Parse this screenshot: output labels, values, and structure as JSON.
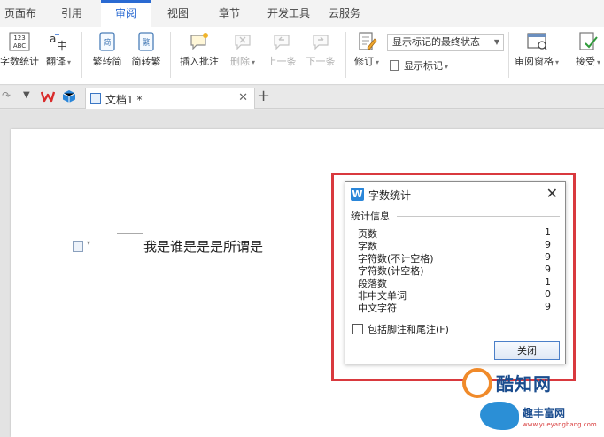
{
  "menu": {
    "tabs": [
      {
        "label": "页面布局"
      },
      {
        "label": "引用"
      },
      {
        "label": "审阅"
      },
      {
        "label": "视图"
      },
      {
        "label": "章节"
      },
      {
        "label": "开发工具"
      },
      {
        "label": "云服务"
      }
    ],
    "active_tab": "审阅"
  },
  "ribbon": {
    "word_count": "字数统计",
    "word_count_icon_text": "123\nABC",
    "translate": "翻译",
    "trad_to_simp": "繁转简",
    "simp_to_trad": "简转繁",
    "insert_comment": "插入批注",
    "delete": "删除",
    "prev": "上一条",
    "next": "下一条",
    "track_changes": "修订",
    "display_select": "显示标记的最终状态",
    "show_markup": "显示标记",
    "review_pane": "审阅窗格",
    "accept": "接受"
  },
  "tabbar": {
    "doc_tab_label": "文档1 *",
    "new_tab": "+"
  },
  "document": {
    "text": "我是谁是是是所谓是"
  },
  "dialog": {
    "title": "字数统计",
    "section_title": "统计信息",
    "stats": [
      {
        "label": "页数",
        "value": "1"
      },
      {
        "label": "字数",
        "value": "9"
      },
      {
        "label": "字符数(不计空格)",
        "value": "9"
      },
      {
        "label": "字符数(计空格)",
        "value": "9"
      },
      {
        "label": "段落数",
        "value": "1"
      },
      {
        "label": "非中文单词",
        "value": "0"
      },
      {
        "label": "中文字符",
        "value": "9"
      }
    ],
    "checkbox_label": "包括脚注和尾注(F)",
    "close_label": "关闭"
  },
  "watermark": {
    "brand": "酷知网",
    "slogan": "趣丰富网",
    "url": "www.yueyangbang.com"
  },
  "colors": {
    "accent": "#2a6ad2",
    "highlight": "#d9393e",
    "dialog_logo": "#2a86d9"
  }
}
